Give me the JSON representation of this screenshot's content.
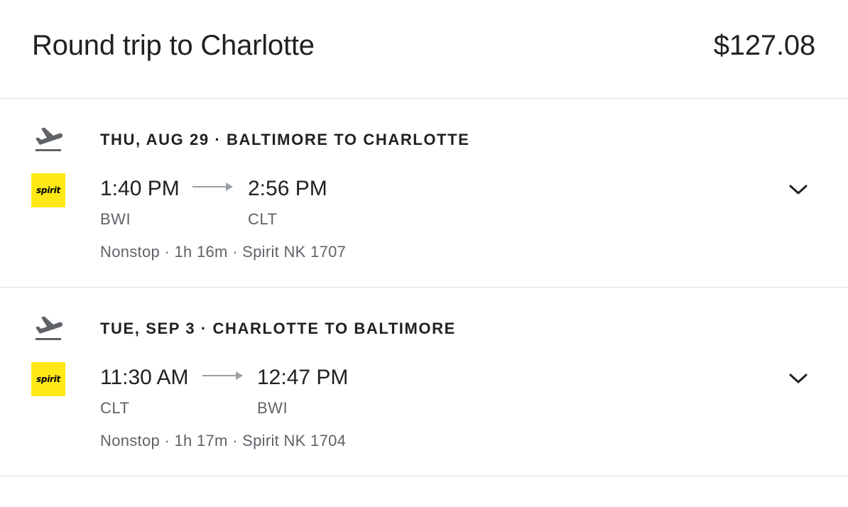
{
  "header": {
    "title": "Round trip to Charlotte",
    "price": "$127.08"
  },
  "legs": [
    {
      "direction_icon": "takeoff-icon",
      "heading": "THU, AUG 29 · BALTIMORE TO CHARLOTTE",
      "airline_logo_text": "spirit",
      "departure_time": "1:40 PM",
      "arrival_time": "2:56 PM",
      "departure_airport": "BWI",
      "arrival_airport": "CLT",
      "details": "Nonstop · 1h 16m · Spirit NK 1707"
    },
    {
      "direction_icon": "takeoff-icon",
      "heading": "TUE, SEP 3 · CHARLOTTE TO BALTIMORE",
      "airline_logo_text": "spirit",
      "departure_time": "11:30 AM",
      "arrival_time": "12:47 PM",
      "departure_airport": "CLT",
      "arrival_airport": "BWI",
      "details": "Nonstop · 1h 17m · Spirit NK 1704"
    }
  ],
  "colors": {
    "spirit_yellow": "#ffe815",
    "divider": "#e0e0e0",
    "secondary_text": "#5f6368",
    "primary_text": "#202124"
  }
}
